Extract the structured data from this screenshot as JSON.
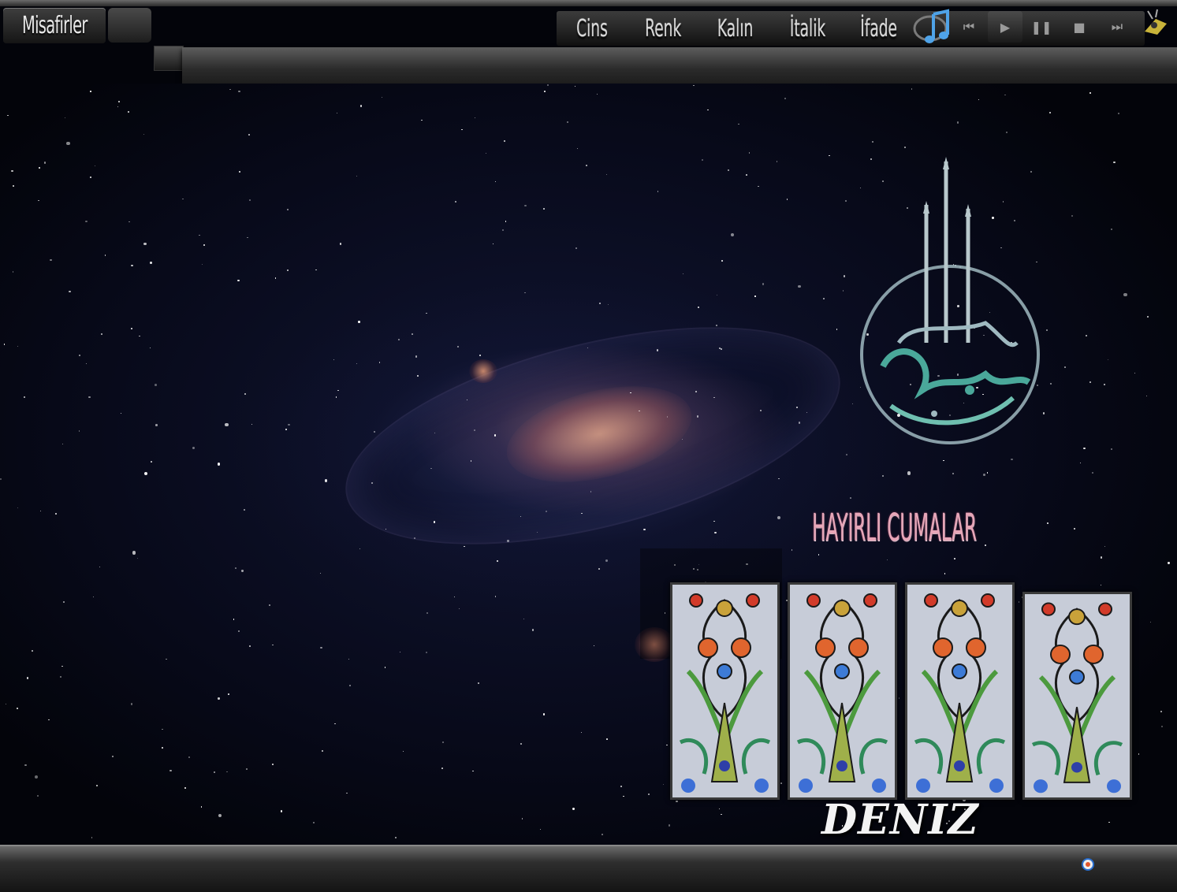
{
  "header": {
    "user_tab_label": "Misafirler"
  },
  "format_toolbar": {
    "buttons": [
      {
        "label": "Cins"
      },
      {
        "label": "Renk"
      },
      {
        "label": "Kalın"
      },
      {
        "label": "İtalik"
      },
      {
        "label": "İfade"
      }
    ]
  },
  "player": {
    "controls": [
      {
        "icon": "previous-icon",
        "glyph": "⏮"
      },
      {
        "icon": "play-icon",
        "glyph": "▶"
      },
      {
        "icon": "pause-icon",
        "glyph": "❚❚"
      },
      {
        "icon": "stop-icon",
        "glyph": "■"
      },
      {
        "icon": "next-icon",
        "glyph": "⏭"
      }
    ]
  },
  "content": {
    "greeting": "HAYIRLI CUMALAR",
    "signature": "DENIZ"
  },
  "colors": {
    "accent_pink": "#e7a6b8",
    "bar_dark": "#1d1d1d",
    "calligraphy_teal": "#4aa89a"
  }
}
